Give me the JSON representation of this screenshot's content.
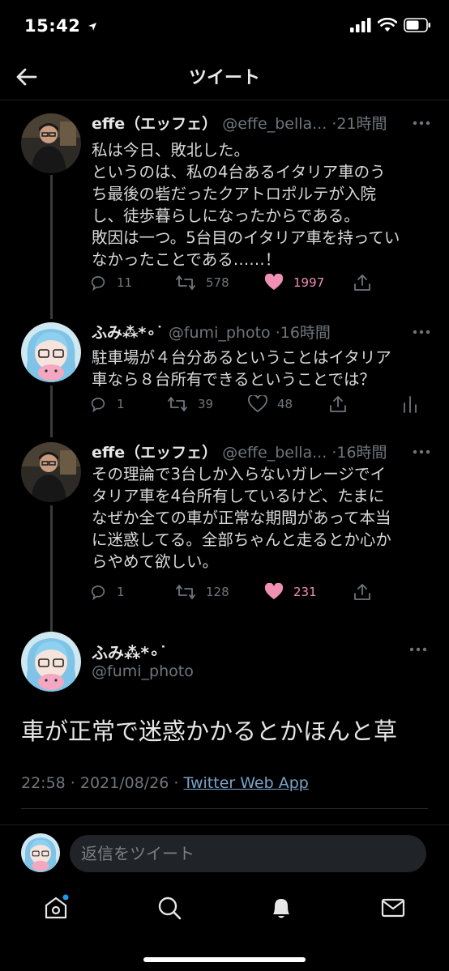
{
  "status": {
    "time": "15:42"
  },
  "nav": {
    "title": "ツイート"
  },
  "tweets": [
    {
      "name": "effe（エッフェ）",
      "handle": "@effe_bella...",
      "time": "·21時間",
      "lines": [
        "私は今日、敗北した。",
        "というのは、私の4台あるイタリア車のう",
        "ち最後の砦だったクアトロポルテが入院",
        "し、徒歩暮らしになったからである。",
        "敗因は一つ。5台目のイタリア車を持ってい",
        "なかったことである……！"
      ],
      "replies": "11",
      "retweets": "578",
      "likes": "1997"
    },
    {
      "name": "ふみ⁂*∘˙",
      "handle": "@fumi_photo",
      "time": "·16時間",
      "lines": [
        "駐車場が４台分あるということはイタリア",
        "車なら８台所有できるということでは？"
      ],
      "replies": "1",
      "retweets": "39",
      "likes": "48"
    },
    {
      "name": "effe（エッフェ）",
      "handle": "@effe_bella...",
      "time": "·16時間",
      "lines": [
        "その理論で3台しか入らないガレージでイ",
        "タリア車を4台所有しているけど、たまに",
        "なぜか全ての車が正常な期間があって本当",
        "に迷惑してる。全部ちゃんと走るとか心か",
        "らやめて欲しい。"
      ],
      "replies": "1",
      "retweets": "128",
      "likes": "231"
    }
  ],
  "main_tweet": {
    "name": "ふみ⁂*∘˙",
    "handle": "@fumi_photo",
    "text": "車が正常で迷惑かかるとかほんと草",
    "datetime": "22:58 · 2021/08/26 · ",
    "source": "Twitter Web App"
  },
  "reply": {
    "placeholder": "返信をツイート"
  },
  "colors": {
    "like": "#f190b5",
    "link": "#7aa3c9",
    "muted": "#6e767d"
  }
}
